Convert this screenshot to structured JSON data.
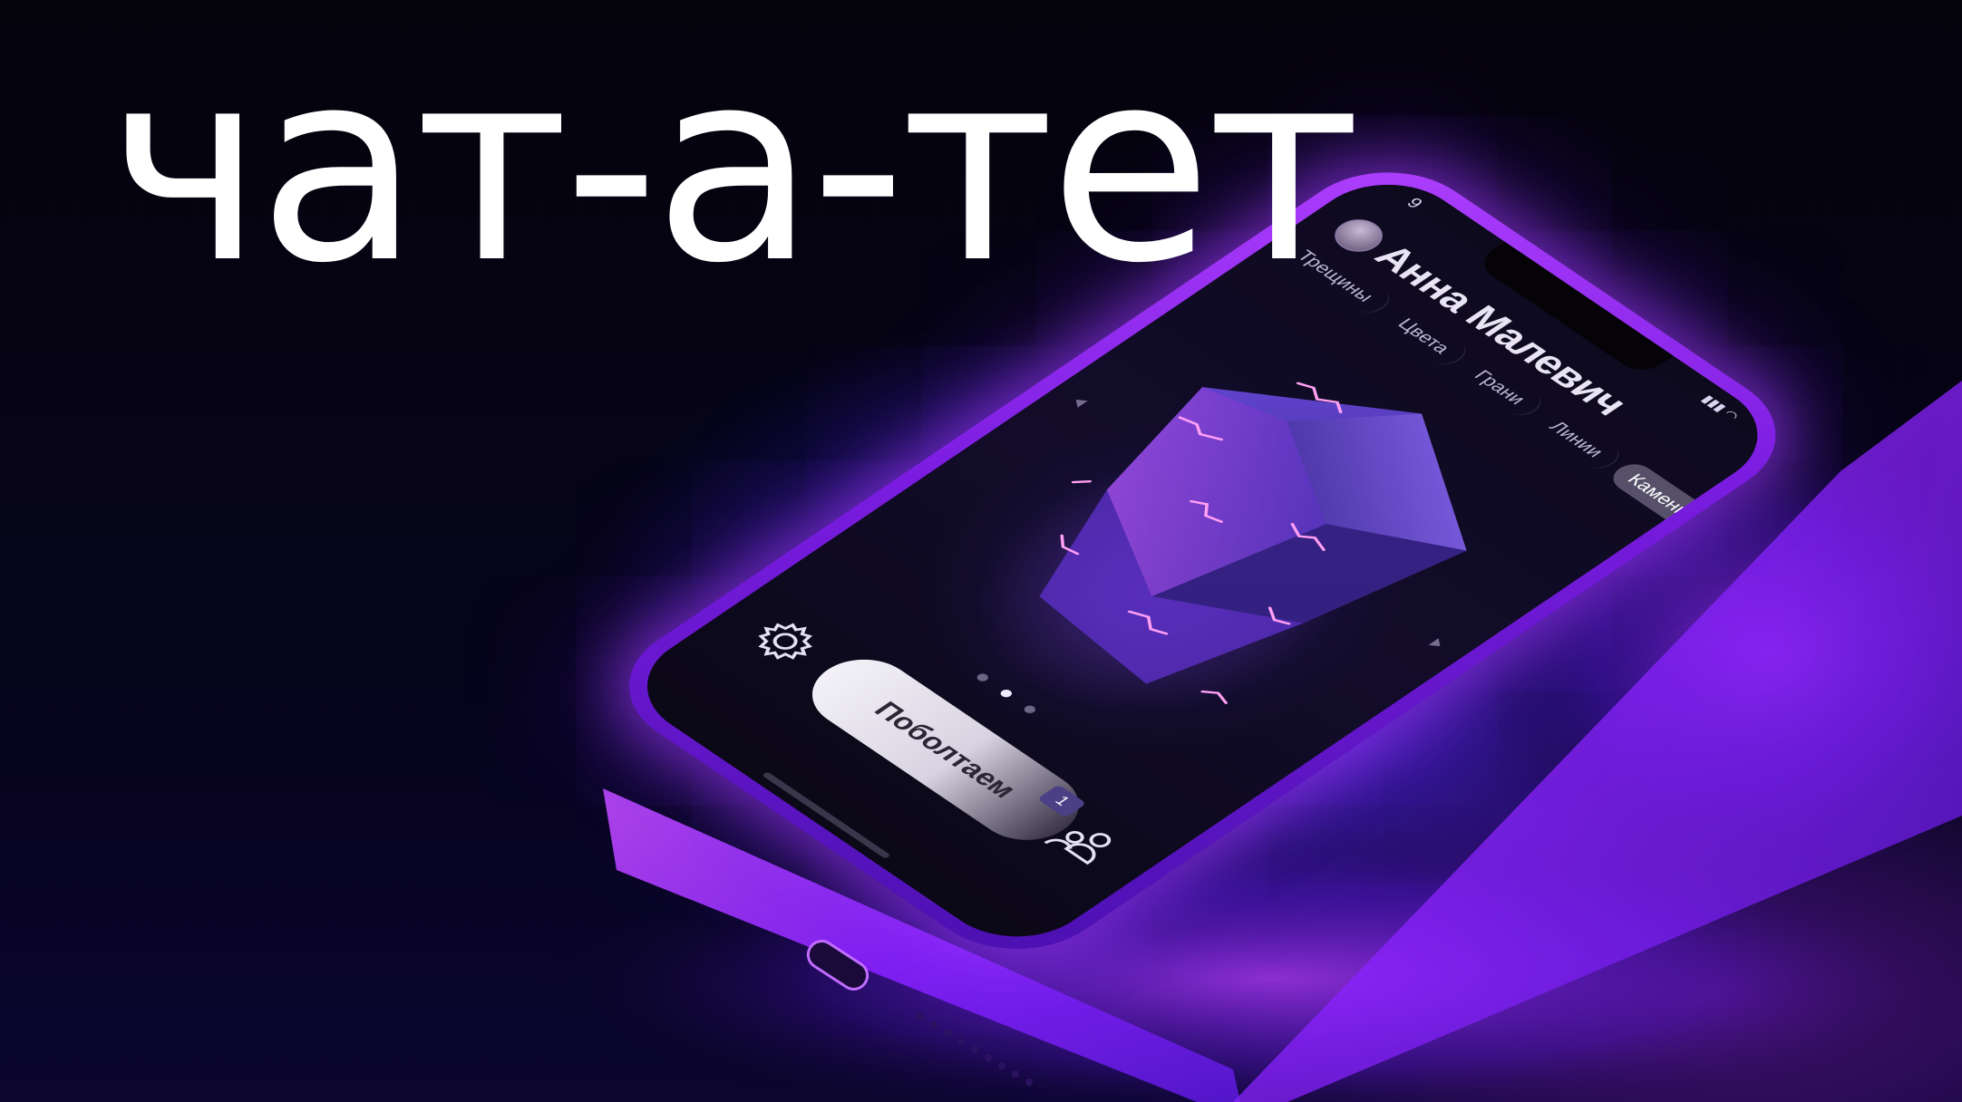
{
  "headline": "чат-а-тет",
  "phone": {
    "status_time": "9",
    "contact": {
      "name": "Анна Малевич"
    },
    "tabs": [
      {
        "label": "Трещины",
        "active": false
      },
      {
        "label": "Цвета",
        "active": false
      },
      {
        "label": "Грани",
        "active": false
      },
      {
        "label": "Линии",
        "active": false
      },
      {
        "label": "Камень",
        "active": true
      }
    ],
    "pager": {
      "count": 3,
      "active_index": 1
    },
    "chat_button": {
      "label": "Поболтаем",
      "badge": "1"
    },
    "icons": {
      "settings": "gear-icon",
      "profile": "people-icon"
    }
  },
  "colors": {
    "accent": "#9b3cff",
    "glow": "#5a2cff",
    "text": "#ffffff"
  }
}
